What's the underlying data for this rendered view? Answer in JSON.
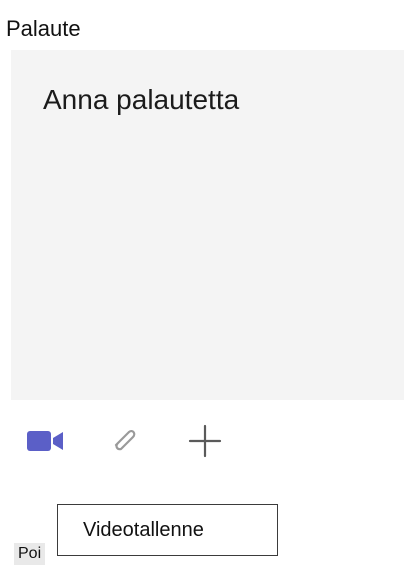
{
  "section": {
    "title": "Palaute"
  },
  "feedback": {
    "placeholder": "Anna palautetta"
  },
  "toolbar": {
    "video_icon": "video-camera-icon",
    "attach_icon": "paperclip-icon",
    "add_icon": "plus-icon",
    "accent_color": "#5b5fc7",
    "icon_gray": "#9a9a9a"
  },
  "tooltip": {
    "text": "Videotallenne"
  },
  "footer": {
    "label": "Poi"
  }
}
